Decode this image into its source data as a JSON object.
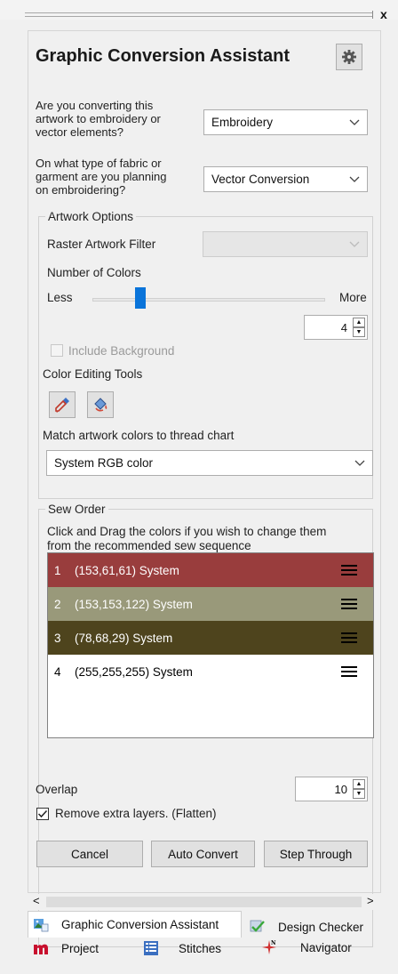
{
  "window": {
    "close_glyph": "x"
  },
  "panel": {
    "title": "Graphic Conversion Assistant",
    "settings_icon": "gear-icon"
  },
  "q1": {
    "label_lines": [
      "Are you converting this",
      "artwork to embroidery or",
      "vector elements?"
    ],
    "value": "Embroidery"
  },
  "q2": {
    "label_lines": [
      "On what type of fabric or",
      "garment are you planning",
      "on embroidering?"
    ],
    "value": "Vector Conversion"
  },
  "artwork_options": {
    "legend": "Artwork Options",
    "raster_filter_label": "Raster Artwork Filter",
    "raster_filter_value": "",
    "number_of_colors_label": "Number of Colors",
    "less_label": "Less",
    "more_label": "More",
    "colors_slider_fraction": 0.25,
    "colors_value": "4",
    "include_background_label": "Include Background",
    "include_background_checked": false,
    "include_background_enabled": false,
    "color_editing_tools_label": "Color Editing Tools",
    "tools": [
      "eyedropper-icon",
      "paint-bucket-icon"
    ],
    "match_label": "Match artwork colors to thread chart",
    "thread_chart_value": "System RGB color"
  },
  "sew_order": {
    "legend": "Sew Order",
    "instructions_lines": [
      "Click and Drag the colors if you wish to change them",
      "from the recommended sew sequence"
    ],
    "items": [
      {
        "num": "1",
        "label": "(153,61,61) System",
        "color": "#993d3d",
        "text_color": "#ffffff"
      },
      {
        "num": "2",
        "label": "(153,153,122) System",
        "color": "#99997a",
        "text_color": "#ffffff"
      },
      {
        "num": "3",
        "label": "(78,68,29) System",
        "color": "#4e441d",
        "text_color": "#ffffff"
      },
      {
        "num": "4",
        "label": "(255,255,255) System",
        "color": "#ffffff",
        "text_color": "#000000"
      }
    ]
  },
  "overlap": {
    "label": "Overlap",
    "value": "10"
  },
  "flatten": {
    "label": "Remove extra layers. (Flatten)",
    "checked": true
  },
  "buttons": {
    "cancel": "Cancel",
    "auto_convert": "Auto Convert",
    "step_through": "Step Through"
  },
  "scrollbar": {
    "left_arrow": "<",
    "right_arrow": ">"
  },
  "tabs_row1": [
    {
      "label": "Graphic Conversion Assistant",
      "icon": "image-convert-icon",
      "active": true
    },
    {
      "label": "Design Checker",
      "icon": "checkmark-icon",
      "active": false
    }
  ],
  "tabs_row2": [
    {
      "label": "Project",
      "icon": "m-logo-icon"
    },
    {
      "label": "Stitches",
      "icon": "stitches-list-icon"
    },
    {
      "label": "Navigator",
      "icon": "compass-icon",
      "icon_letter": "N"
    }
  ],
  "colors": {
    "accent": "#0a74da",
    "panel_bg": "#f0f0f0"
  }
}
